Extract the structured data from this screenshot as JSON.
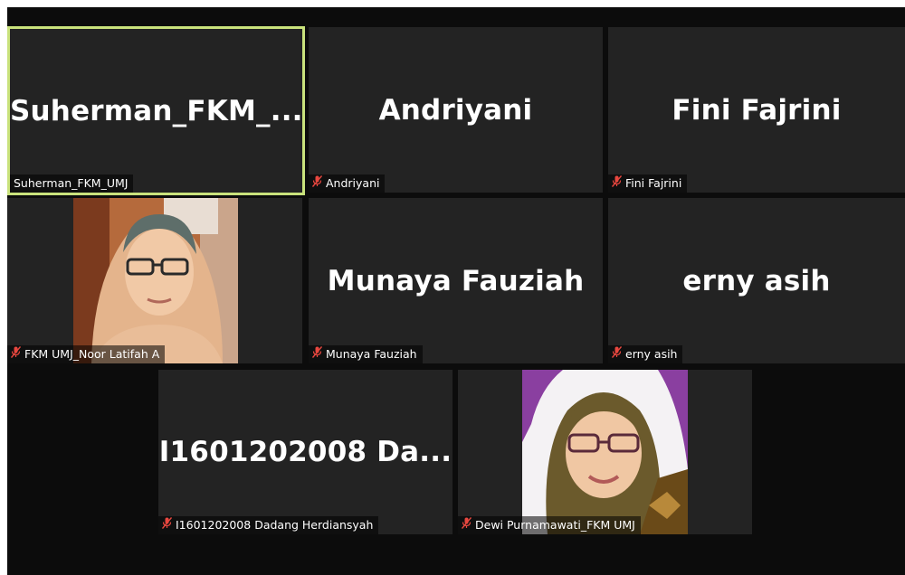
{
  "meeting": {
    "tiles": [
      {
        "display": "Suherman_FKM_...",
        "label": "Suherman_FKM_UMJ",
        "muted": false,
        "active": true
      },
      {
        "display": "Andriyani",
        "label": "Andriyani",
        "muted": true
      },
      {
        "display": "Fini Fajrini",
        "label": "Fini Fajrini",
        "muted": true
      },
      {
        "display": "",
        "label": "FKM UMJ_Noor Latifah A",
        "muted": true,
        "video": true
      },
      {
        "display": "Munaya Fauziah",
        "label": "Munaya Fauziah",
        "muted": true
      },
      {
        "display": "erny asih",
        "label": "erny asih",
        "muted": true
      },
      {
        "display": "I1601202008  Da...",
        "label": "I1601202008 Dadang Herdiansyah",
        "muted": true
      },
      {
        "display": "",
        "label": "Dewi Purnamawati_FKM UMJ",
        "muted": true,
        "video": true
      }
    ]
  },
  "colors": {
    "active_border": "#c9e27c",
    "muted_icon": "#e8473f",
    "tile_bg": "#232323",
    "stage_bg": "#0c0c0c"
  },
  "icons": {
    "muted": "muted-mic-icon"
  }
}
